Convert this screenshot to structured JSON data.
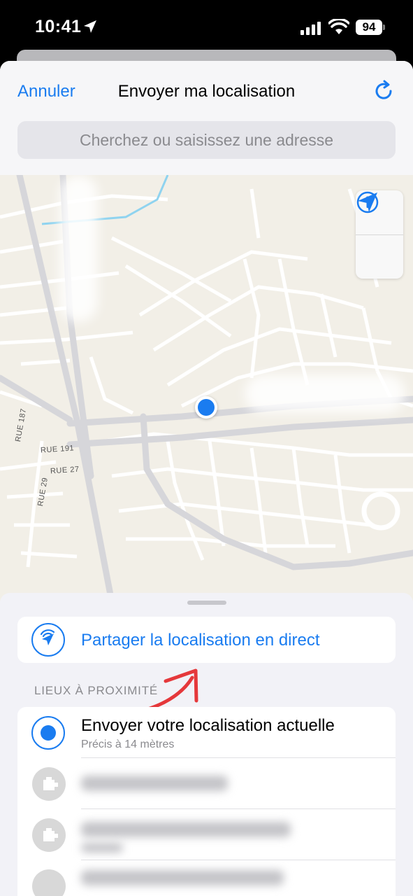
{
  "status_bar": {
    "time": "10:41",
    "battery": "94"
  },
  "nav": {
    "cancel": "Annuler",
    "title": "Envoyer ma localisation"
  },
  "search": {
    "placeholder": "Cherchez ou saisissez une adresse"
  },
  "map": {
    "streets": [
      "RUE 191",
      "RUE 27",
      "RUE 187",
      "RUE 29"
    ]
  },
  "live_share": {
    "label": "Partager la localisation en direct"
  },
  "nearby": {
    "header": "LIEUX À PROXIMITÉ",
    "current": {
      "title": "Envoyer votre localisation actuelle",
      "subtitle": "Précis à 14 mètres"
    }
  },
  "colors": {
    "accent": "#1a7cf0",
    "annotation_arrow": "#e5383b"
  }
}
